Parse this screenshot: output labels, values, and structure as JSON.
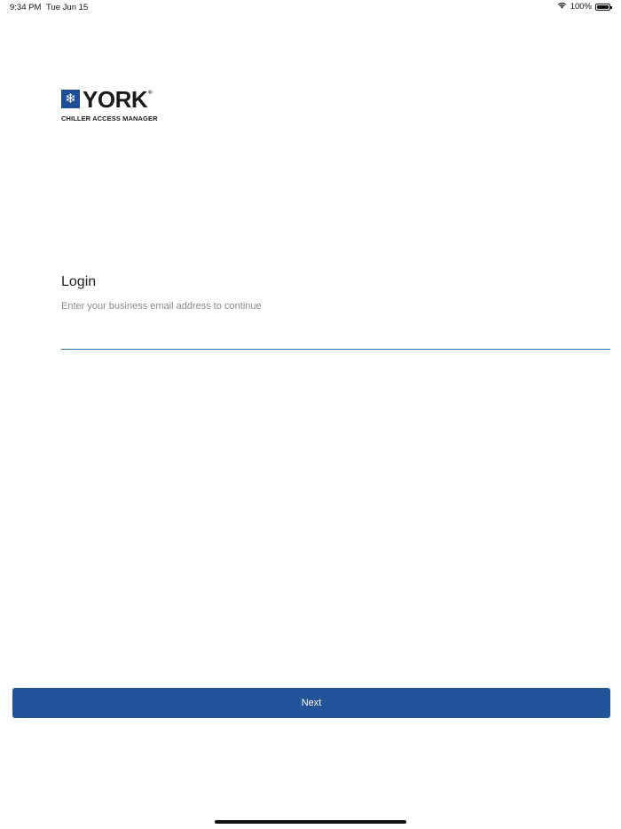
{
  "status_bar": {
    "time": "9:34 PM",
    "date": "Tue Jun 15",
    "battery_percent": "100%",
    "icons": [
      "wifi-icon",
      "battery-icon"
    ]
  },
  "logo": {
    "wordmark": "YORK",
    "registered": "®",
    "subtitle": "CHILLER ACCESS MANAGER",
    "mark_icon": "snowflake-icon",
    "brand_color": "#1f4e96"
  },
  "login": {
    "title": "Login",
    "subtitle": "Enter your business email address to continue",
    "email_value": "",
    "email_placeholder": ""
  },
  "actions": {
    "next_label": "Next",
    "button_color": "#23549a"
  }
}
